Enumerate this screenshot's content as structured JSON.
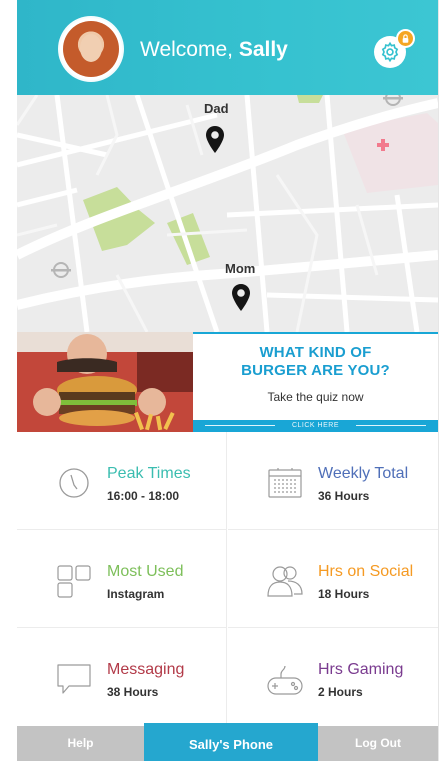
{
  "header": {
    "welcome_prefix": "Welcome,",
    "user_name": "Sally"
  },
  "map": {
    "pins": [
      {
        "label": "Dad"
      },
      {
        "label": "Mom"
      }
    ]
  },
  "banner": {
    "title_line1": "WHAT KIND OF",
    "title_line2": "BURGER ARE YOU?",
    "subtitle": "Take the quiz now",
    "cta": "CLICK HERE"
  },
  "stats": [
    {
      "title": "Peak Times",
      "value": "16:00 - 18:00",
      "color": "#3bbdb0",
      "icon": "clock-icon"
    },
    {
      "title": "Weekly Total",
      "value": "36 Hours",
      "color": "#4f6fb8",
      "icon": "calendar-icon"
    },
    {
      "title": "Most Used",
      "value": "Instagram",
      "color": "#7dbf5a",
      "icon": "apps-grid-icon"
    },
    {
      "title": "Hrs on Social",
      "value": "18 Hours",
      "color": "#f59a23",
      "icon": "users-icon"
    },
    {
      "title": "Messaging",
      "value": "38 Hours",
      "color": "#b23a48",
      "icon": "chat-bubble-icon"
    },
    {
      "title": "Hrs Gaming",
      "value": "2 Hours",
      "color": "#7a3b8f",
      "icon": "gamepad-icon"
    }
  ],
  "bottom_nav": {
    "help": "Help",
    "phone": "Sally's Phone",
    "logout": "Log Out"
  },
  "colors": {
    "header": "#35c1cf",
    "accent_blue": "#25a7cf",
    "nav_gray": "#c3c3c3"
  }
}
